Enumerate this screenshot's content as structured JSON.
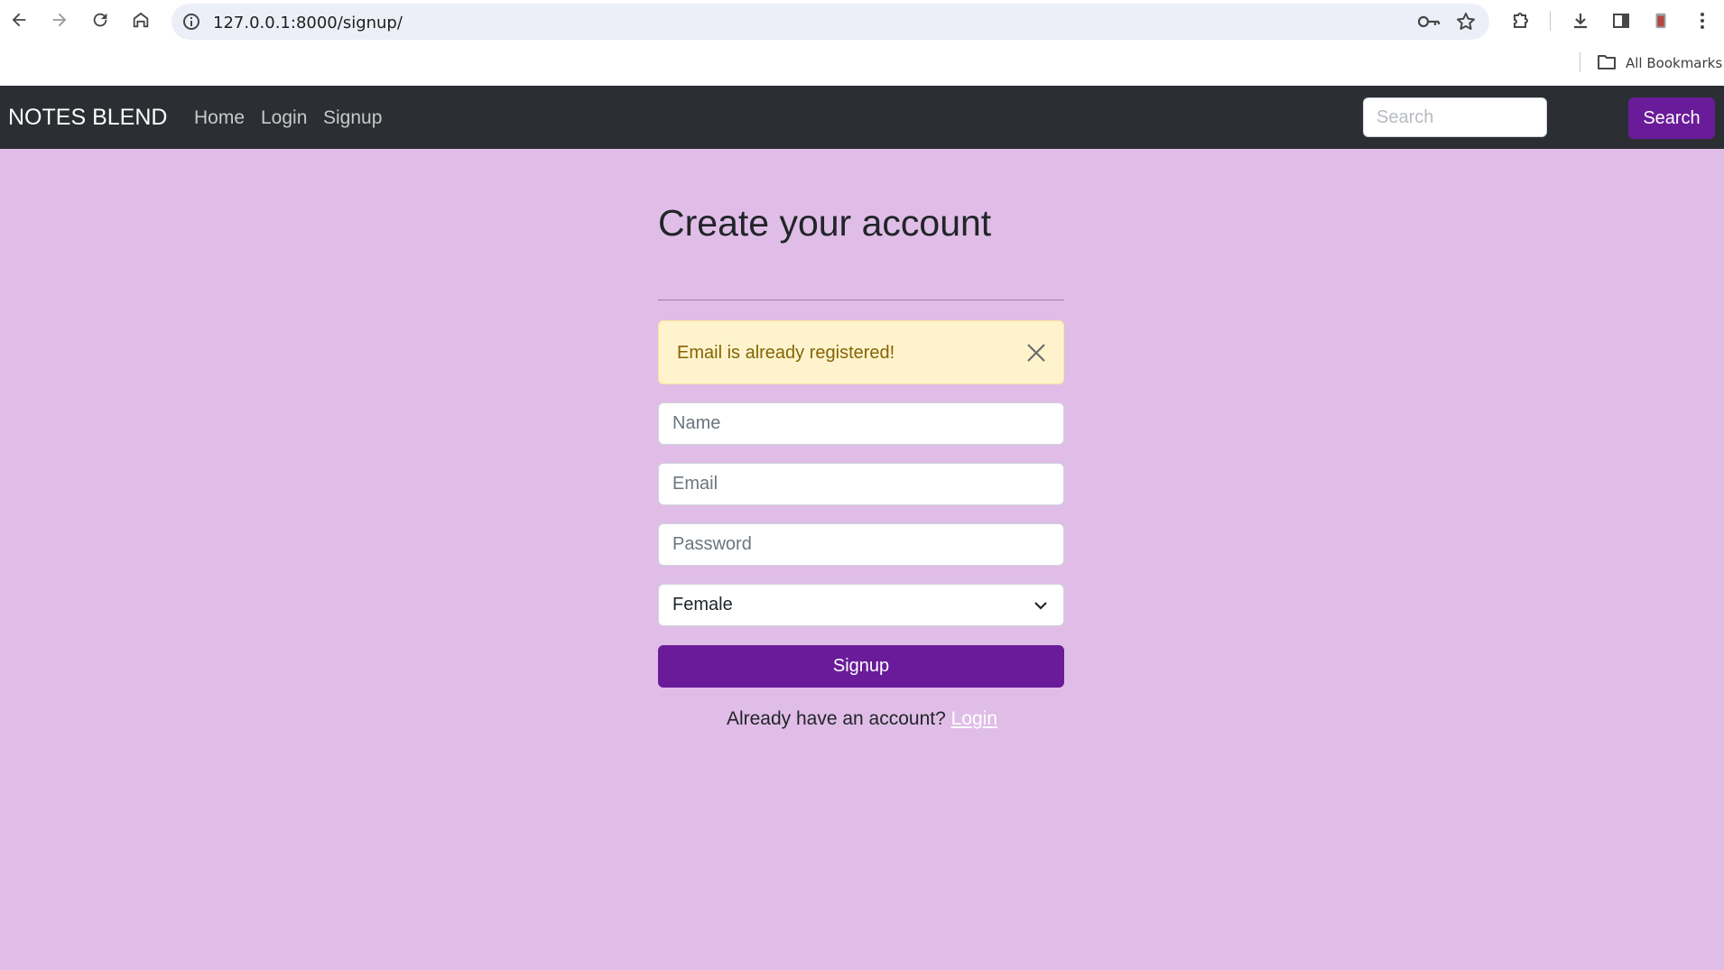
{
  "browser": {
    "url": "127.0.0.1:8000/signup/",
    "bookmarks_label": "All Bookmarks"
  },
  "navbar": {
    "brand": "NOTES BLEND",
    "links": [
      "Home",
      "Login",
      "Signup"
    ],
    "search_placeholder": "Search",
    "search_button": "Search"
  },
  "form": {
    "title": "Create your account",
    "alert": "Email is already registered!",
    "name_placeholder": "Name",
    "email_placeholder": "Email",
    "password_placeholder": "Password",
    "gender_selected": "Female",
    "submit_label": "Signup",
    "footer_prefix": "Already have an account?",
    "footer_link": "Login"
  },
  "colors": {
    "page_background": "#e0bde7",
    "navbar_background": "#2b2f33",
    "accent": "#6a1b9a",
    "alert_background": "#fff3cd"
  }
}
